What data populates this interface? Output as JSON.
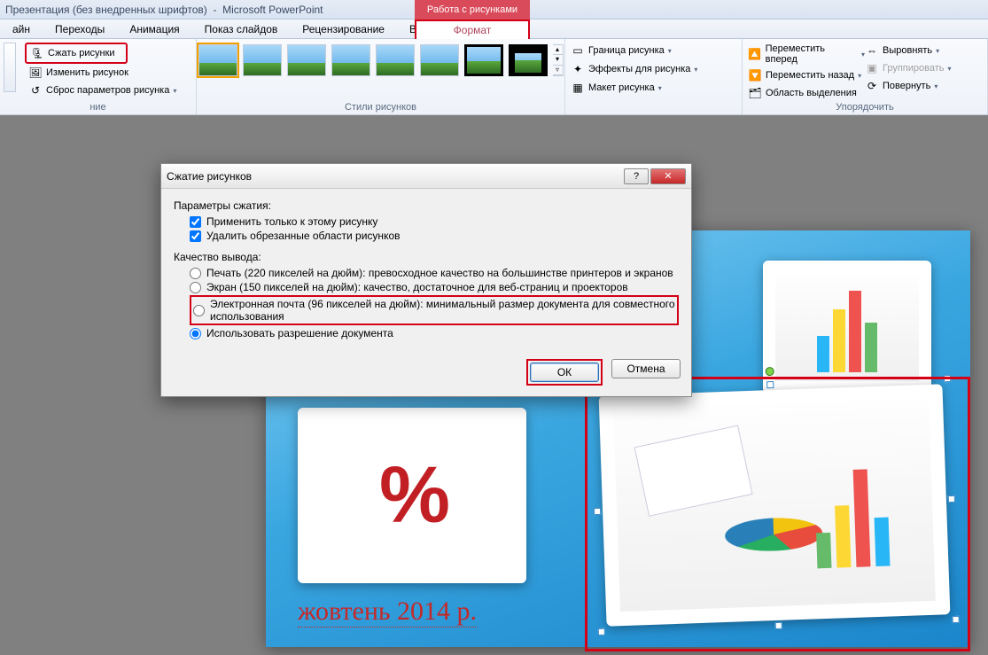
{
  "titlebar": {
    "doc": "Презентация (без внедренных шрифтов)",
    "app": "Microsoft PowerPoint",
    "context": "Работа с рисунками"
  },
  "tabs": {
    "items": [
      "айн",
      "Переходы",
      "Анимация",
      "Показ слайдов",
      "Рецензирование",
      "Вид",
      "Формат"
    ],
    "active": "Формат"
  },
  "ribbon": {
    "group1": {
      "compress": "Сжать рисунки",
      "change": "Изменить рисунок",
      "reset": "Сброс параметров рисунка",
      "label": "ние"
    },
    "group2": {
      "label": "Стили рисунков"
    },
    "group3": {
      "border": "Граница рисунка",
      "effects": "Эффекты для рисунка",
      "layout": "Макет рисунка"
    },
    "group4": {
      "forward": "Переместить вперед",
      "backward": "Переместить назад",
      "select": "Область выделения",
      "align": "Выровнять",
      "group": "Группировать",
      "rotate": "Повернуть",
      "label": "Упорядочить"
    }
  },
  "slide": {
    "footer": "жовтень 2014 р."
  },
  "dialog": {
    "title": "Сжатие рисунков",
    "section1": "Параметры сжатия:",
    "opt_apply": "Применить только к этому рисунку",
    "opt_crop": "Удалить обрезанные области рисунков",
    "section2": "Качество вывода:",
    "q_print": "Печать (220 пикселей на дюйм): превосходное качество на большинстве принтеров и экранов",
    "q_screen": "Экран (150 пикселей на дюйм): качество, достаточное для веб-страниц и проекторов",
    "q_email": "Электронная почта (96 пикселей на дюйм): минимальный размер документа для совместного использования",
    "q_doc": "Использовать разрешение документа",
    "ok": "ОК",
    "cancel": "Отмена"
  }
}
